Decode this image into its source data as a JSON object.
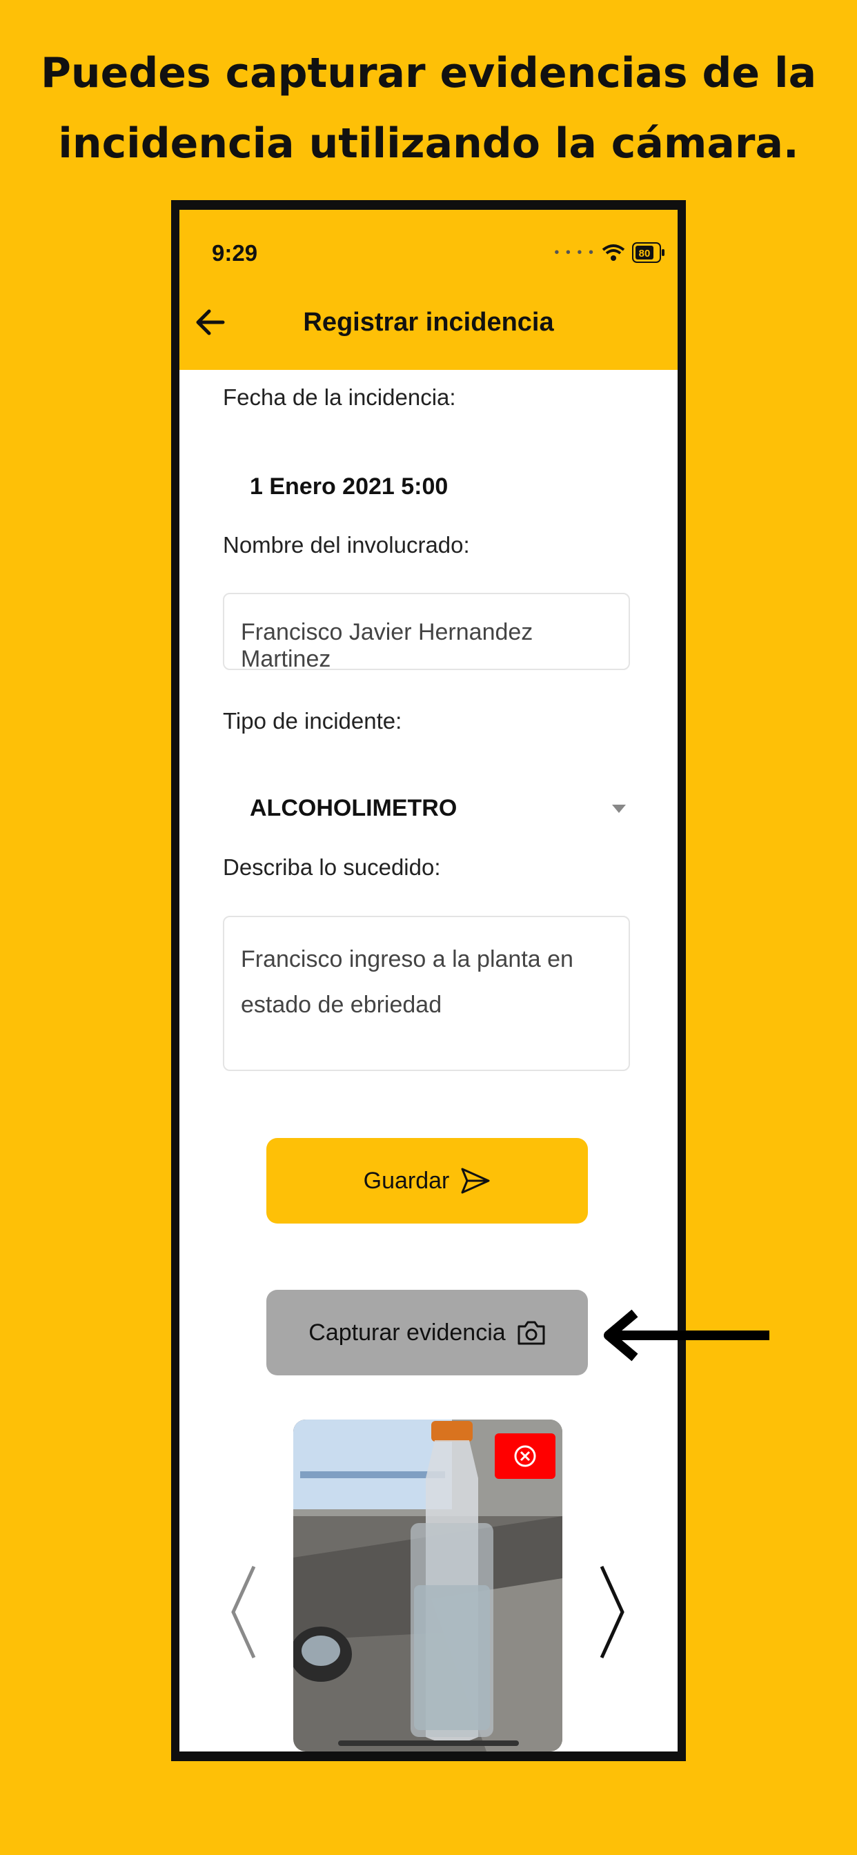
{
  "headline": "Puedes capturar evidencias de la incidencia utilizando la cámara.",
  "status": {
    "time": "9:29",
    "battery": "80"
  },
  "nav": {
    "title": "Registrar incidencia"
  },
  "form": {
    "date_label": "Fecha de la incidencia:",
    "date_value": "1 Enero 2021 5:00",
    "name_label": "Nombre del involucrado:",
    "name_value": "Francisco Javier Hernandez Martinez",
    "type_label": "Tipo de incidente:",
    "type_value": "ALCOHOLIMETRO",
    "desc_label": "Describa lo sucedido:",
    "desc_line1": "Francisco ingreso a la planta en",
    "desc_line2": "estado de ebriedad"
  },
  "buttons": {
    "save": "Guardar",
    "capture": "Capturar evidencia"
  },
  "colors": {
    "brand": "#FEC007",
    "capture_button": "#A7A7A7",
    "delete": "#FF0000"
  },
  "icons": [
    "back-arrow-icon",
    "send-icon",
    "camera-icon",
    "delete-icon",
    "chevron-left-icon",
    "chevron-right-icon",
    "wifi-icon",
    "battery-icon"
  ]
}
